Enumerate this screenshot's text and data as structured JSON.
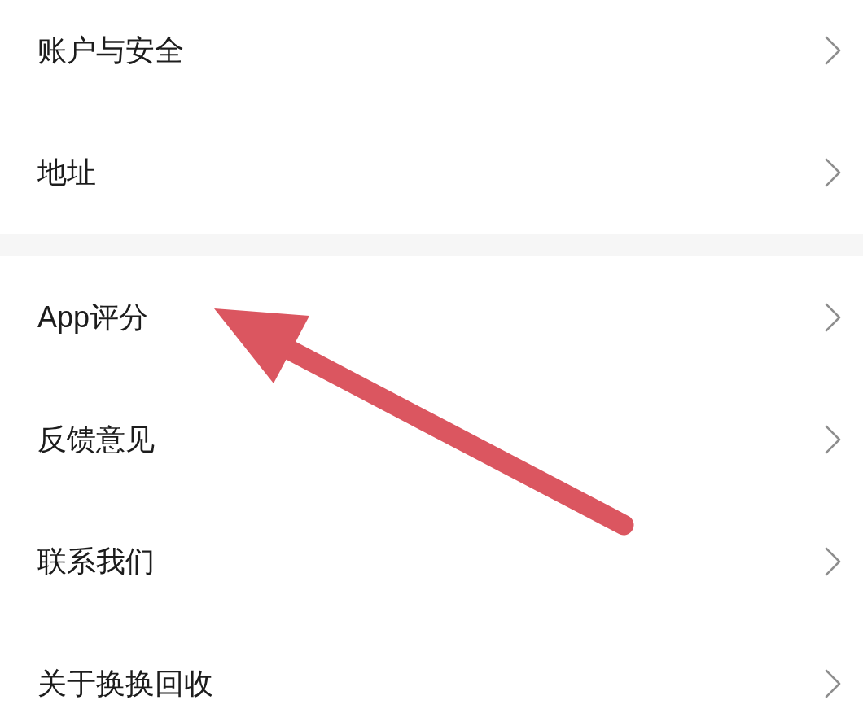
{
  "sections": [
    {
      "items": [
        {
          "label": "账户与安全"
        },
        {
          "label": "地址"
        }
      ]
    },
    {
      "items": [
        {
          "label": "App评分"
        },
        {
          "label": "反馈意见"
        },
        {
          "label": "联系我们"
        },
        {
          "label": "关于换换回收"
        }
      ]
    }
  ]
}
